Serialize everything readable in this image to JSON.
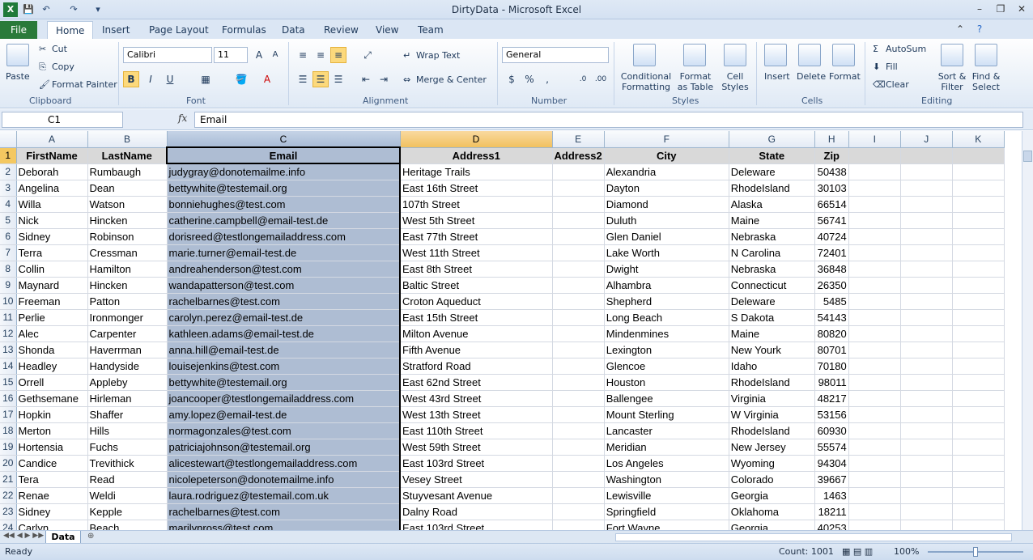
{
  "window": {
    "title": "DirtyData - Microsoft Excel",
    "minimize": "–",
    "maximize": "❐",
    "close": "✕"
  },
  "tabs": [
    "File",
    "Home",
    "Insert",
    "Page Layout",
    "Formulas",
    "Data",
    "Review",
    "View",
    "Team"
  ],
  "clipboard": {
    "paste": "Paste",
    "cut": "Cut",
    "copy": "Copy",
    "format_painter": "Format Painter",
    "label": "Clipboard"
  },
  "font": {
    "name": "Calibri",
    "size": "11",
    "bold": "B",
    "italic": "I",
    "underline": "U",
    "label": "Font"
  },
  "alignment": {
    "wrap_text": "Wrap Text",
    "merge_center": "Merge & Center",
    "label": "Alignment"
  },
  "number": {
    "format": "General",
    "currency": "$",
    "percent": "%",
    "comma": ",",
    "label": "Number"
  },
  "styles": {
    "conditional_formatting": "Conditional Formatting",
    "format_as_table": "Format as Table",
    "cell_styles": "Cell Styles",
    "label": "Styles"
  },
  "cells": {
    "insert": "Insert",
    "delete": "Delete",
    "format": "Format",
    "label": "Cells"
  },
  "editing": {
    "autosum": "AutoSum",
    "fill": "Fill",
    "clear": "Clear",
    "sort_filter": "Sort & Filter",
    "find_select": "Find & Select",
    "label": "Editing"
  },
  "formula_bar": {
    "name_box": "C1",
    "fx": "fx",
    "value": "Email"
  },
  "columns": [
    "A",
    "B",
    "C",
    "D",
    "E",
    "F",
    "G",
    "H",
    "I",
    "J",
    "K"
  ],
  "header_row": [
    "FirstName",
    "LastName",
    "Email",
    "Address1",
    "Address2",
    "City",
    "State",
    "Zip"
  ],
  "rows": [
    [
      "Deborah",
      "Rumbaugh",
      "judygray@donotemailme.info",
      "Heritage Trails",
      "",
      "Alexandria",
      "Deleware",
      "50438"
    ],
    [
      "Angelina",
      "Dean",
      "bettywhite@testemail.org",
      "East 16th Street",
      "",
      "Dayton",
      "RhodeIsland",
      "30103"
    ],
    [
      "Willa",
      "Watson",
      "bonniehughes@test.com",
      "107th Street",
      "",
      "Diamond",
      "Alaska",
      "66514"
    ],
    [
      "Nick",
      "Hincken",
      "catherine.campbell@email-test.de",
      "West 5th Street",
      "",
      "Duluth",
      "Maine",
      "56741"
    ],
    [
      "Sidney",
      "Robinson",
      "dorisreed@testlongemailaddress.com",
      "East 77th Street",
      "",
      "Glen Daniel",
      "Nebraska",
      "40724"
    ],
    [
      "Terra",
      "Cressman",
      "marie.turner@email-test.de",
      "West 11th Street",
      "",
      "Lake Worth",
      "N Carolina",
      "72401"
    ],
    [
      "Collin",
      "Hamilton",
      "andreahenderson@test.com",
      "East 8th Street",
      "",
      "Dwight",
      "Nebraska",
      "36848"
    ],
    [
      "Maynard",
      "Hincken",
      "wandapatterson@test.com",
      "Baltic Street",
      "",
      "Alhambra",
      "Connecticut",
      "26350"
    ],
    [
      "Freeman",
      "Patton",
      "rachelbarnes@test.com",
      "Croton Aqueduct",
      "",
      "Shepherd",
      "Deleware",
      "5485"
    ],
    [
      "Perlie",
      "Ironmonger",
      "carolyn.perez@email-test.de",
      "East 15th Street",
      "",
      "Long Beach",
      "S Dakota",
      "54143"
    ],
    [
      "Alec",
      "Carpenter",
      "kathleen.adams@email-test.de",
      "Milton Avenue",
      "",
      "Mindenmines",
      "Maine",
      "80820"
    ],
    [
      "Shonda",
      "Haverrman",
      "anna.hill@email-test.de",
      "Fifth Avenue",
      "",
      "Lexington",
      "New Yourk",
      "80701"
    ],
    [
      "Headley",
      "Handyside",
      "louisejenkins@test.com",
      "Stratford Road",
      "",
      "Glencoe",
      "Idaho",
      "70180"
    ],
    [
      "Orrell",
      "Appleby",
      "bettywhite@testemail.org",
      "East 62nd Street",
      "",
      "Houston",
      "RhodeIsland",
      "98011"
    ],
    [
      "Gethsemane",
      "Hirleman",
      "joancooper@testlongemailaddress.com",
      "West 43rd Street",
      "",
      "Ballengee",
      "Virginia",
      "48217"
    ],
    [
      "Hopkin",
      "Shaffer",
      "amy.lopez@email-test.de",
      "West 13th Street",
      "",
      "Mount Sterling",
      "W Virginia",
      "53156"
    ],
    [
      "Merton",
      "Hills",
      "normagonzales@test.com",
      "East 110th Street",
      "",
      "Lancaster",
      "RhodeIsland",
      "60930"
    ],
    [
      "Hortensia",
      "Fuchs",
      "patriciajohnson@testemail.org",
      "West 59th Street",
      "",
      "Meridian",
      "New Jersey",
      "55574"
    ],
    [
      "Candice",
      "Trevithick",
      "alicestewart@testlongemailaddress.com",
      "East 103rd Street",
      "",
      "Los Angeles",
      "Wyoming",
      "94304"
    ],
    [
      "Tera",
      "Read",
      "nicolepeterson@donotemailme.info",
      "Vesey Street",
      "",
      "Washington",
      "Colorado",
      "39667"
    ],
    [
      "Renae",
      "Weldi",
      "laura.rodriguez@testemail.com.uk",
      "Stuyvesant Avenue",
      "",
      "Lewisville",
      "Georgia",
      "1463"
    ],
    [
      "Sidney",
      "Kepple",
      "rachelbarnes@test.com",
      "Dalny Road",
      "",
      "Springfield",
      "Oklahoma",
      "18211"
    ],
    [
      "Carlyn",
      "Beach",
      "marilynross@test.com",
      "East 103rd Street",
      "",
      "Fort Wayne",
      "Georgia",
      "40253"
    ]
  ],
  "sheet_tab": "Data",
  "status": {
    "ready": "Ready",
    "count": "Count: 1001",
    "zoom": "100%"
  }
}
